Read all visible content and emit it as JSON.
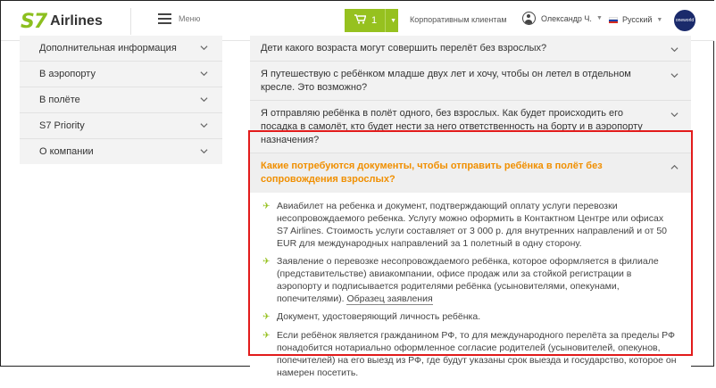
{
  "header": {
    "logo_mark": "S7",
    "logo_text": "Airlines",
    "menu_label": "Меню",
    "cart_count": "1",
    "corporate_link": "Корпоративным клиентам",
    "user_name": "Олександр Ч.",
    "language": "Русский",
    "alliance_badge": "oneworld",
    "accent_color": "#96c11f"
  },
  "sidebar": {
    "items": [
      {
        "label": "Дополнительная информация"
      },
      {
        "label": "В аэропорту"
      },
      {
        "label": "В полёте"
      },
      {
        "label": "S7 Priority"
      },
      {
        "label": "О компании"
      }
    ]
  },
  "faq": {
    "questions": [
      {
        "text": "Дети какого возраста могут совершить перелёт без взрослых?"
      },
      {
        "text": "Я путешествую с ребёнком младше двух лет и хочу, чтобы он летел в отдельном кресле. Это возможно?"
      },
      {
        "text": "Я отправляю ребёнка в полёт одного, без взрослых. Как будет происходить его посадка в самолёт, кто будет нести за него ответственность на борту и в аэропорту назначения?"
      }
    ],
    "open_question": "Какие потребуются документы, чтобы отправить ребёнка в полёт без сопровождения взрослых?",
    "answers": [
      {
        "text": "Авиабилет на ребенка и документ, подтверждающий оплату услуги перевозки несопровождаемого ребенка. Услугу можно оформить в Контактном Центре или офисах S7 Airlines. Стоимость услуги составляет от 3 000 р. для внутренних направлений и от 50 EUR для международных направлений за 1 полетный в одну сторону."
      },
      {
        "text": "Заявление о перевозке несопровождаемого ребёнка, которое оформляется в филиале (представительстве) авиакомпании, офисе продаж или за стойкой регистрации в аэропорту и подписывается родителями ребёнка (усыновителями, опекунами, попечителями).",
        "link": "Образец заявления"
      },
      {
        "text": "Документ, удостоверяющий личность ребёнка."
      },
      {
        "text": "Если ребёнок является гражданином РФ, то для международного перелёта за пределы РФ понадобится нотариально оформленное согласие родителей (усыновителей, опекунов, попечителей) на его выезд из РФ, где будут указаны срок выезда и государство, которое он намерен посетить."
      }
    ]
  },
  "colors": {
    "accent_orange": "#f08f00",
    "highlight_red": "#e21b1b"
  }
}
